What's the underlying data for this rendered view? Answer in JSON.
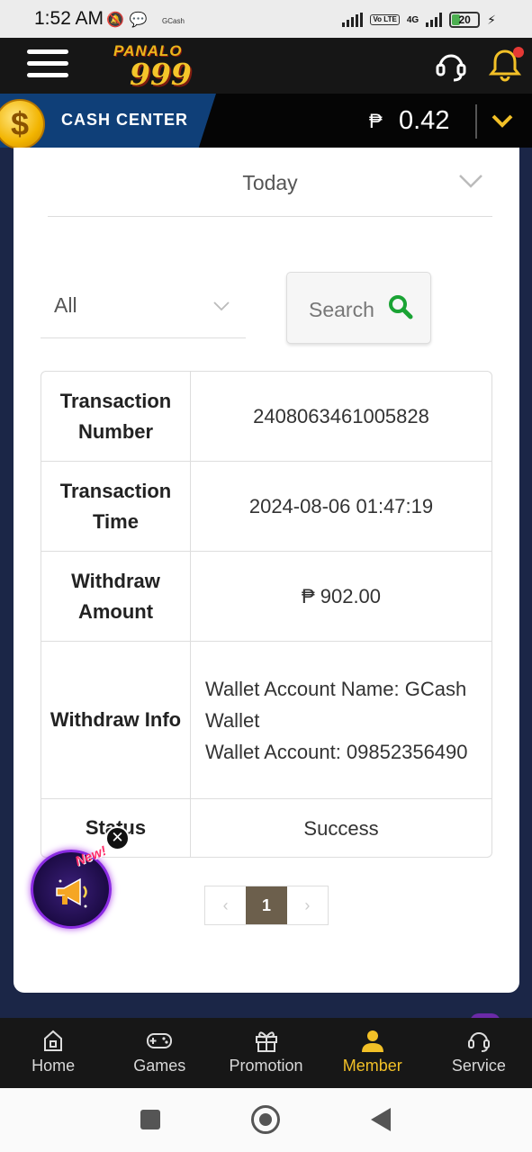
{
  "status_bar": {
    "time": "1:52 AM",
    "notif_text": "GCash",
    "volte": "Vo LTE",
    "network": "4G",
    "battery": "20"
  },
  "header": {
    "logo_line1": "PANALO",
    "logo_line2": "999"
  },
  "cash_center": {
    "label": "CASH CENTER",
    "currency_symbol": "₱",
    "balance": "0.42"
  },
  "filters": {
    "period": "Today",
    "type": "All",
    "search_label": "Search"
  },
  "transaction": {
    "rows": [
      {
        "label": "Transaction Number",
        "value": "2408063461005828"
      },
      {
        "label": "Transaction Time",
        "value": "2024-08-06 01:47:19"
      },
      {
        "label": "Withdraw Amount",
        "value": "₱ 902.00"
      },
      {
        "label": "Withdraw Info",
        "value": "Wallet Account Name: GCash Wallet\nWallet Account: 09852356490"
      },
      {
        "label": "Status",
        "value": "Success"
      }
    ]
  },
  "pagination": {
    "prev": "‹",
    "current": "1",
    "next": "›"
  },
  "promo": {
    "badge": "New!",
    "close": "✕"
  },
  "bottom_nav": {
    "items": [
      {
        "label": "Home",
        "icon": "home-icon"
      },
      {
        "label": "Games",
        "icon": "gamepad-icon"
      },
      {
        "label": "Promotion",
        "icon": "gift-icon"
      },
      {
        "label": "Member",
        "icon": "person-icon"
      },
      {
        "label": "Service",
        "icon": "headset-icon"
      }
    ],
    "active": "Member"
  },
  "colors": {
    "accent": "#f2c027",
    "header_bg": "#161616",
    "cash_blue": "#0f3f78",
    "search_icon": "#1aa334",
    "page_bg": "#1b2647"
  }
}
